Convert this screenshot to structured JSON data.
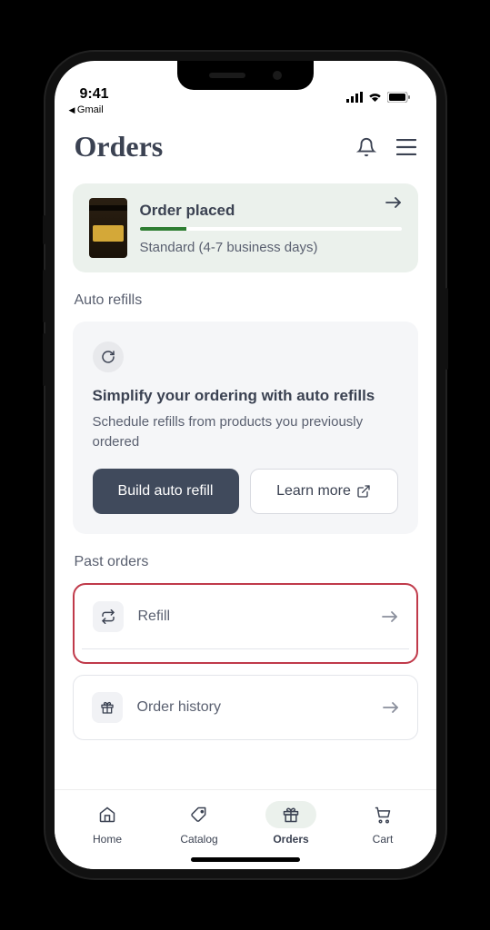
{
  "status": {
    "time": "9:41",
    "back_app": "Gmail"
  },
  "header": {
    "title": "Orders"
  },
  "order_card": {
    "title": "Order placed",
    "subtitle": "Standard (4-7 business days)"
  },
  "auto_refills": {
    "section": "Auto refills",
    "title": "Simplify your ordering with auto refills",
    "desc": "Schedule refills from products you previously ordered",
    "primary": "Build auto refill",
    "secondary": "Learn more"
  },
  "past": {
    "section": "Past orders",
    "refill": "Refill",
    "history": "Order history"
  },
  "tabs": {
    "home": "Home",
    "catalog": "Catalog",
    "orders": "Orders",
    "cart": "Cart"
  }
}
